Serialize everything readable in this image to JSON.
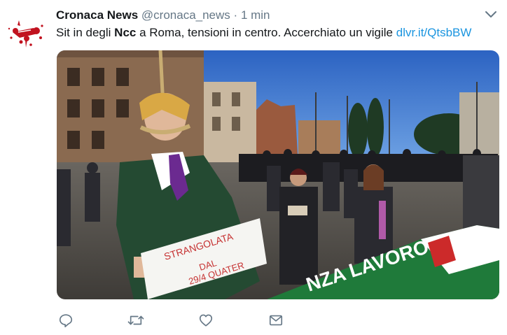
{
  "tweet": {
    "author_name": "Cronaca News",
    "author_handle": "@cronaca_news",
    "separator": "·",
    "time": "1 min",
    "text_part1": "Sit in degli ",
    "text_bold": "Ncc",
    "text_part2": " a Roma, tensioni in centro. Accerchiato un vigile ",
    "link_text": "dlvr.it/QtsbBW",
    "sign_text_line1": "STRANGOLATA",
    "sign_text_line2": "DAL",
    "sign_text_line3": "29/4 QUATER",
    "banner_text": "NZA LAVORO"
  },
  "icons": {
    "avatar": "blood-splatter-logo",
    "caret": "chevron-down-icon",
    "reply": "reply-icon",
    "retweet": "retweet-icon",
    "like": "like-icon",
    "dm": "envelope-icon"
  },
  "colors": {
    "link": "#1b95e0",
    "secondary_text": "#657786",
    "icon": "#657786",
    "logo_red": "#c1121f"
  }
}
